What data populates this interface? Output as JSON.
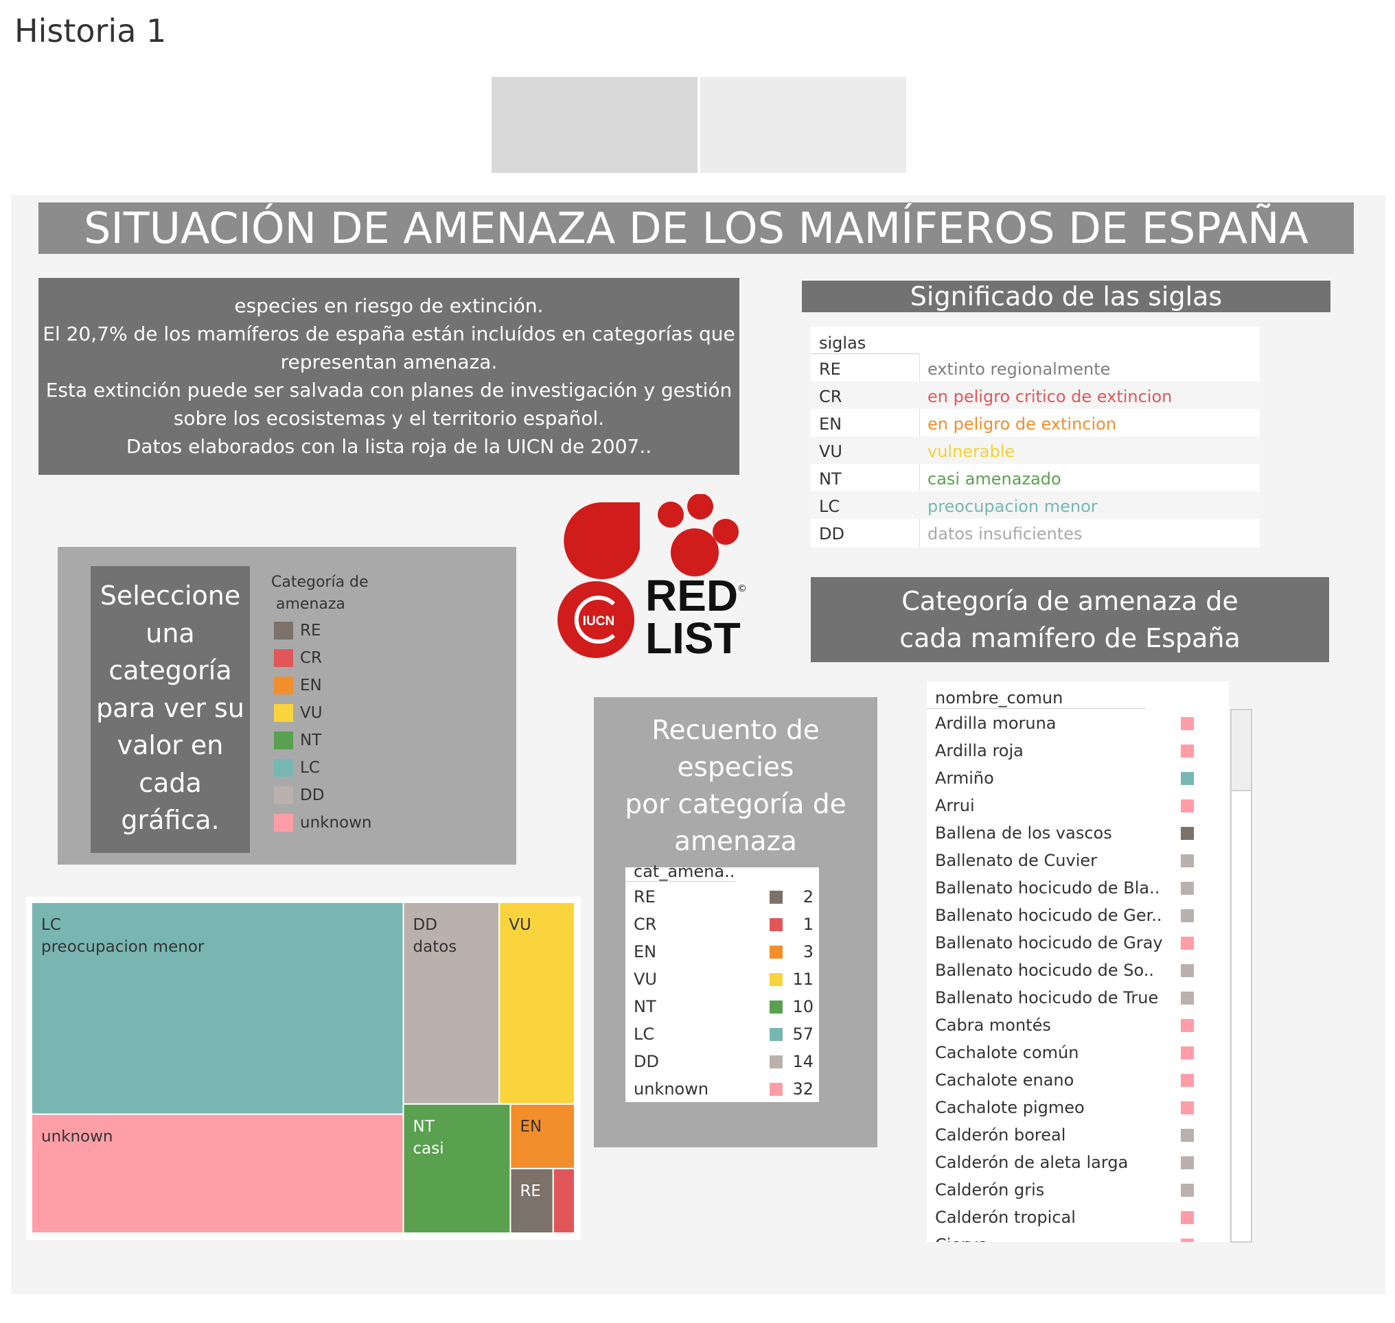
{
  "story": {
    "title": "Historia 1"
  },
  "nav_tiles": [
    {
      "color": "#d9d9d9"
    },
    {
      "color": "#ececec"
    }
  ],
  "main_title": "SITUACIÓN DE AMENAZA DE LOS MAMÍFEROS DE ESPAÑA",
  "description_lines": [
    "especies en riesgo de extinción.",
    "El 20,7% de los mamíferos de españa están incluídos en categorías que",
    "representan amenaza.",
    "Esta extinción puede ser salvada con planes de investigación y gestión",
    "sobre los ecosistemas y el territorio español.",
    "Datos elaborados con la lista roja de la UICN de 2007.."
  ],
  "siglas": {
    "header": "Significado de las siglas",
    "column": "siglas",
    "rows": [
      {
        "code": "RE",
        "desc": "extinto regionalmente",
        "color": "#7f7f7f"
      },
      {
        "code": "CR",
        "desc": "en peligro critico de extincion",
        "color": "#e15759"
      },
      {
        "code": "EN",
        "desc": "en peligro de extincion",
        "color": "#f28e2b"
      },
      {
        "code": "VU",
        "desc": "vulnerable",
        "color": "#f5cf3a"
      },
      {
        "code": "NT",
        "desc": "casi amenazado",
        "color": "#59a14f"
      },
      {
        "code": "LC",
        "desc": "preocupacion menor",
        "color": "#76b7b2"
      },
      {
        "code": "DD",
        "desc": "datos insuficientes",
        "color": "#a8a8a8"
      }
    ]
  },
  "filter": {
    "instruction_lines": [
      "Seleccione",
      "una",
      "categoría",
      "para ver su",
      "valor en",
      "cada",
      "gráfica."
    ],
    "legend_title_lines": [
      "Categoría de",
      " amenaza"
    ],
    "legend": [
      {
        "label": "RE",
        "color": "#7c7269"
      },
      {
        "label": "CR",
        "color": "#e15759"
      },
      {
        "label": "EN",
        "color": "#f28e2b"
      },
      {
        "label": "VU",
        "color": "#f9d43d"
      },
      {
        "label": "NT",
        "color": "#59a14f"
      },
      {
        "label": "LC",
        "color": "#76b7b2"
      },
      {
        "label": "DD",
        "color": "#bab0ac"
      },
      {
        "label": "unknown",
        "color": "#ff9da7"
      }
    ]
  },
  "logo": {
    "line1": "RED",
    "line2": "LIST",
    "badge": "IUCN",
    "mark": "©",
    "color": "#d01c1b"
  },
  "amenaza_header_lines": [
    "Categoría de amenaza de",
    "cada mamífero de España"
  ],
  "recuento": {
    "title_lines": [
      "Recuento de especies",
      "por categoría de",
      "amenaza"
    ],
    "column": "cat_amena..",
    "rows": [
      {
        "cat": "RE",
        "value": "2",
        "color": "#7c7269"
      },
      {
        "cat": "CR",
        "value": "1",
        "color": "#e15759"
      },
      {
        "cat": "EN",
        "value": "3",
        "color": "#f28e2b"
      },
      {
        "cat": "VU",
        "value": "11",
        "color": "#f9d43d"
      },
      {
        "cat": "NT",
        "value": "10",
        "color": "#59a14f"
      },
      {
        "cat": "LC",
        "value": "57",
        "color": "#76b7b2"
      },
      {
        "cat": "DD",
        "value": "14",
        "color": "#bab0ac"
      },
      {
        "cat": "unknown",
        "value": "32",
        "color": "#ff9da7"
      }
    ]
  },
  "chart_data": {
    "type": "treemap",
    "title": "",
    "nodes": [
      {
        "category": "LC",
        "label_lines": [
          "LC",
          "preocupacion menor"
        ],
        "value": 57,
        "color": "#79b6b1",
        "text_color": "#333333"
      },
      {
        "category": "unknown",
        "label_lines": [
          "unknown"
        ],
        "value": 32,
        "color": "#fe9ea7",
        "text_color": "#333333"
      },
      {
        "category": "DD",
        "label_lines": [
          "DD",
          "datos"
        ],
        "value": 14,
        "color": "#bab0ac",
        "text_color": "#333333"
      },
      {
        "category": "VU",
        "label_lines": [
          "VU"
        ],
        "value": 11,
        "color": "#f9d43d",
        "text_color": "#333333"
      },
      {
        "category": "NT",
        "label_lines": [
          "NT",
          "casi"
        ],
        "value": 10,
        "color": "#59a14f",
        "text_color": "#ffffff"
      },
      {
        "category": "EN",
        "label_lines": [
          "EN"
        ],
        "value": 3,
        "color": "#f28e2b",
        "text_color": "#333333"
      },
      {
        "category": "RE",
        "label_lines": [
          "RE"
        ],
        "value": 2,
        "color": "#7c7269",
        "text_color": "#ffffff"
      },
      {
        "category": "CR",
        "label_lines": [],
        "value": 1,
        "color": "#e15759",
        "text_color": "#ffffff"
      }
    ]
  },
  "species": {
    "column": "nombre_comun",
    "rows": [
      {
        "name": "Ardilla moruna",
        "color": "#ff9da7"
      },
      {
        "name": "Ardilla roja",
        "color": "#ff9da7"
      },
      {
        "name": "Armiño",
        "color": "#76b7b2"
      },
      {
        "name": "Arrui",
        "color": "#ff9da7"
      },
      {
        "name": "Ballena de los vascos",
        "color": "#7c7269"
      },
      {
        "name": "Ballenato de Cuvier",
        "color": "#bab0ac"
      },
      {
        "name": "Ballenato hocicudo de Bla..",
        "color": "#bab0ac"
      },
      {
        "name": "Ballenato hocicudo de Ger..",
        "color": "#bab0ac"
      },
      {
        "name": "Ballenato hocicudo de Gray",
        "color": "#ff9da7"
      },
      {
        "name": "Ballenato hocicudo de So..",
        "color": "#bab0ac"
      },
      {
        "name": "Ballenato hocicudo de True",
        "color": "#bab0ac"
      },
      {
        "name": "Cabra montés",
        "color": "#ff9da7"
      },
      {
        "name": "Cachalote común",
        "color": "#ff9da7"
      },
      {
        "name": "Cachalote enano",
        "color": "#ff9da7"
      },
      {
        "name": "Cachalote pigmeo",
        "color": "#ff9da7"
      },
      {
        "name": "Calderón boreal",
        "color": "#bab0ac"
      },
      {
        "name": "Calderón de aleta larga",
        "color": "#bab0ac"
      },
      {
        "name": "Calderón gris",
        "color": "#bab0ac"
      },
      {
        "name": "Calderón tropical",
        "color": "#ff9da7"
      },
      {
        "name": "Ciervo",
        "color": "#ff9da7"
      }
    ]
  }
}
